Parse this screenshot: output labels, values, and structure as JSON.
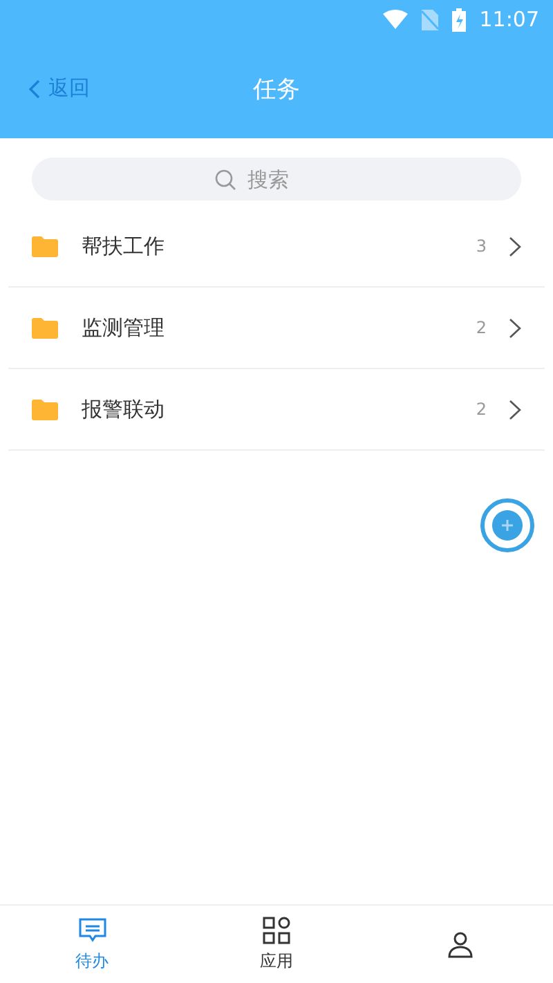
{
  "status_bar": {
    "time": "11:07"
  },
  "header": {
    "back": "返回",
    "title": "任务"
  },
  "search": {
    "placeholder": "搜索"
  },
  "folders": [
    {
      "name": "帮扶工作",
      "count": "3"
    },
    {
      "name": "监测管理",
      "count": "2"
    },
    {
      "name": "报警联动",
      "count": "2"
    }
  ],
  "tabs": [
    {
      "kind": "todo",
      "label": "待办",
      "selected": true
    },
    {
      "kind": "apps",
      "label": "应用",
      "selected": false
    },
    {
      "kind": "person",
      "selected": false
    }
  ]
}
